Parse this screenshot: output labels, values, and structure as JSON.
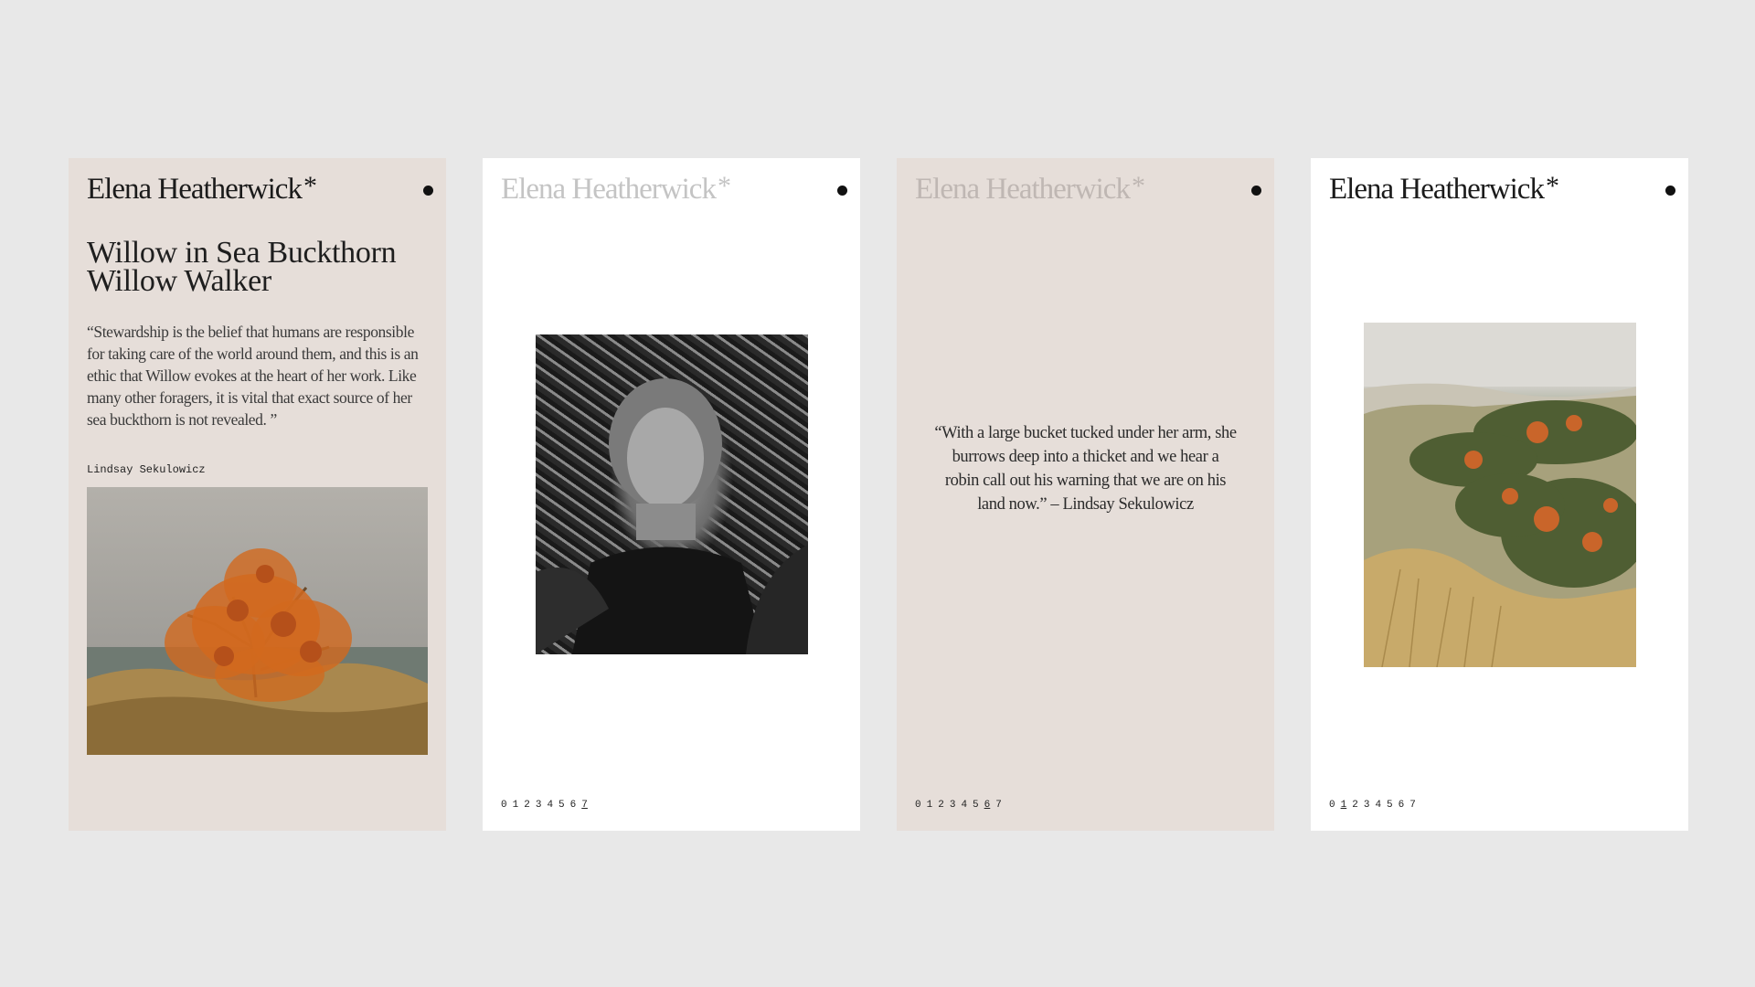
{
  "brand": {
    "name": "Elena Heatherwick",
    "mark": "*"
  },
  "card1": {
    "title_line1": "Willow in Sea Buckthorn",
    "title_line2": "Willow Walker",
    "quote": "“Stewardship is the belief that humans are responsible for taking care of the world around them, and this is an ethic that Willow evokes at the heart of her work. Like many other foragers, it is vital that exact source of her sea buckthorn is not revealed. ”",
    "author": "Lindsay Sekulowicz"
  },
  "card3": {
    "quote": "“With a large bucket tucked under her arm, she burrows deep into a thicket and we hear a robin call out his warning that we are on his land now.” – Lindsay Sekulowicz"
  },
  "pager": [
    "0",
    "1",
    "2",
    "3",
    "4",
    "5",
    "6",
    "7"
  ],
  "colors": {
    "background": "#e8e8e8",
    "card_beige": "#e6ded9",
    "card_white": "#ffffff",
    "text": "#1b1b1b",
    "faded_text": "#c4c4c4",
    "buckthorn_orange": "#d2691e"
  },
  "icons": {
    "menu": "menu-dot-icon"
  }
}
